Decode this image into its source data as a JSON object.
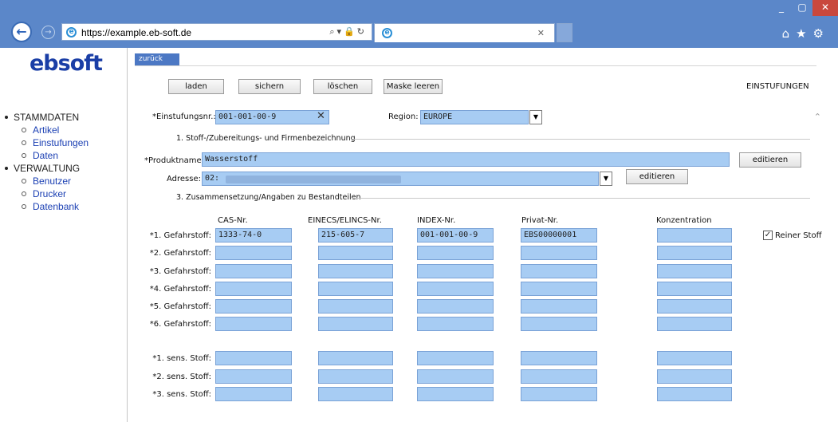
{
  "browser": {
    "url": "https://example.eb-soft.de",
    "window_buttons": {
      "minimize": "_",
      "maximize": "▢",
      "close": "✕"
    }
  },
  "sidebar": {
    "logo": "ebsoft",
    "sections": [
      {
        "label": "STAMMDATEN",
        "items": [
          "Artikel",
          "Einstufungen",
          "Daten"
        ]
      },
      {
        "label": "VERWALTUNG",
        "items": [
          "Benutzer",
          "Drucker",
          "Datenbank"
        ]
      }
    ]
  },
  "page": {
    "back_link": "zurück",
    "title": "EINSTUFUNGEN",
    "toolbar": {
      "load": "laden",
      "save": "sichern",
      "delete": "löschen",
      "clear": "Maske leeren"
    },
    "einstufung": {
      "label": "*Einstufungsnr.:",
      "value": "001-001-00-9"
    },
    "region": {
      "label": "Region:",
      "value": "EUROPE"
    },
    "section1": "1. Stoff-/Zubereitungs- und Firmenbezeichnung",
    "produkt": {
      "label": "*Produktname:",
      "value": "Wasserstoff",
      "edit": "editieren"
    },
    "adresse": {
      "label": "Adresse:",
      "value": "02:",
      "edit": "editieren"
    },
    "section3": "3. Zusammensetzung/Angaben zu Bestandteilen",
    "columns": [
      "CAS-Nr.",
      "EINECS/ELINCS-Nr.",
      "INDEX-Nr.",
      "Privat-Nr.",
      "Konzentration"
    ],
    "hazard_rows": [
      {
        "label": "*1. Gefahrstoff:",
        "cas": "1333-74-0",
        "einecs": "215-605-7",
        "index": "001-001-00-9",
        "privat": "EBS00000001",
        "konz": ""
      },
      {
        "label": "*2. Gefahrstoff:",
        "cas": "",
        "einecs": "",
        "index": "",
        "privat": "",
        "konz": ""
      },
      {
        "label": "*3. Gefahrstoff:",
        "cas": "",
        "einecs": "",
        "index": "",
        "privat": "",
        "konz": ""
      },
      {
        "label": "*4. Gefahrstoff:",
        "cas": "",
        "einecs": "",
        "index": "",
        "privat": "",
        "konz": ""
      },
      {
        "label": "*5. Gefahrstoff:",
        "cas": "",
        "einecs": "",
        "index": "",
        "privat": "",
        "konz": ""
      },
      {
        "label": "*6. Gefahrstoff:",
        "cas": "",
        "einecs": "",
        "index": "",
        "privat": "",
        "konz": ""
      }
    ],
    "sens_rows": [
      {
        "label": "*1. sens. Stoff:",
        "cas": "",
        "einecs": "",
        "index": "",
        "privat": "",
        "konz": ""
      },
      {
        "label": "*2. sens. Stoff:",
        "cas": "",
        "einecs": "",
        "index": "",
        "privat": "",
        "konz": ""
      },
      {
        "label": "*3. sens. Stoff:",
        "cas": "",
        "einecs": "",
        "index": "",
        "privat": "",
        "konz": ""
      }
    ],
    "reiner_stoff": {
      "label": "Reiner Stoff",
      "checked": true
    }
  }
}
